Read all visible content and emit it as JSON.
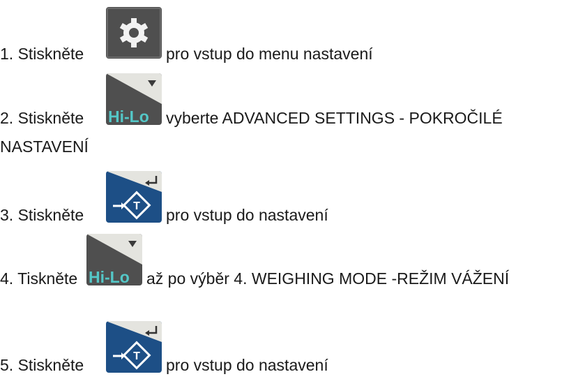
{
  "steps": [
    {
      "num": "1. Stiskněte",
      "text": "pro vstup do menu nastavení",
      "icon": "gear-icon"
    },
    {
      "num": "2. Stiskněte",
      "text": "vyberte ADVANCED SETTINGS - POKROČILÉ",
      "text2": "NASTAVENÍ",
      "icon": "hi-lo-icon"
    },
    {
      "num": "3. Stiskněte",
      "text": "pro vstup do nastavení",
      "icon": "enter-tare-icon"
    },
    {
      "num": "4. Tiskněte",
      "text": "až po výběr 4. WEIGHING MODE -REŽIM VÁŽENÍ",
      "icon": "hi-lo-icon"
    },
    {
      "num": "5. Stiskněte",
      "text": "pro vstup do nastavení",
      "icon": "enter-tare-icon"
    }
  ],
  "icons": {
    "hilo_label": "Hi-Lo",
    "colors": {
      "key_gray": "#4f4f4f",
      "key_blue": "#1d4f86",
      "key_light": "#e4e4df",
      "hilo_text": "#54c7c7"
    }
  }
}
